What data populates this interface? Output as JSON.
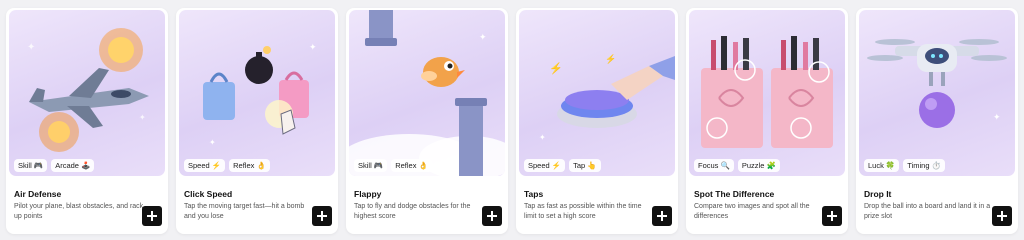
{
  "cards": [
    {
      "title": "Air Defense",
      "description": "Pilot your plane, blast obstacles, and rack up points",
      "tags": [
        "Skill 🎮",
        "Arcade 🕹️"
      ],
      "image_icon": "fighter-jet-icon"
    },
    {
      "title": "Click Speed",
      "description": "Tap the moving target fast—hit a bomb and you lose",
      "tags": [
        "Speed ⚡",
        "Reflex 👌"
      ],
      "image_icon": "shopping-bags-bomb-icon"
    },
    {
      "title": "Flappy",
      "description": "Tap to fly and dodge obstacles for the highest score",
      "tags": [
        "Skill 🎮",
        "Reflex 👌"
      ],
      "image_icon": "flappy-bird-icon"
    },
    {
      "title": "Taps",
      "description": "Tap as fast as possible within the time limit to set a high score",
      "tags": [
        "Speed ⚡",
        "Tap 👆"
      ],
      "image_icon": "push-button-icon"
    },
    {
      "title": "Spot The Difference",
      "description": "Compare two images and spot all the differences",
      "tags": [
        "Focus 🔍",
        "Puzzle 🧩"
      ],
      "image_icon": "cosmetic-bags-icon"
    },
    {
      "title": "Drop It",
      "description": "Drop the ball into a board and land it in a prize slot",
      "tags": [
        "Luck 🍀",
        "Timing ⏱️"
      ],
      "image_icon": "drone-ball-icon"
    }
  ],
  "add_button_icon": "plus-icon"
}
